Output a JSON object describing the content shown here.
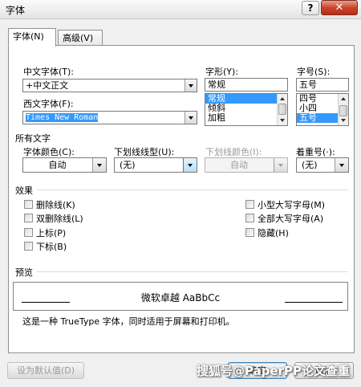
{
  "window": {
    "title": "字体",
    "help": "?",
    "close": "✕"
  },
  "tabs": [
    {
      "label": "字体(N)"
    },
    {
      "label": "高级(V)"
    }
  ],
  "font_tab": {
    "chinese_font": {
      "label": "中文字体(T):",
      "value": "+中文正文"
    },
    "western_font": {
      "label": "西文字体(F):",
      "value": "Times New Roman"
    },
    "style": {
      "label": "字形(Y):",
      "value": "常规",
      "options": [
        "常规",
        "倾斜",
        "加粗"
      ],
      "selected": "常规"
    },
    "size": {
      "label": "字号(S):",
      "value": "五号",
      "options": [
        "四号",
        "小四",
        "五号"
      ],
      "selected": "五号"
    }
  },
  "all_text": {
    "heading": "所有文字",
    "font_color": {
      "label": "字体颜色(C):",
      "value": "自动"
    },
    "underline_type": {
      "label": "下划线线型(U):",
      "value": "(无)"
    },
    "underline_color": {
      "label": "下划线颜色(I):",
      "value": "自动"
    },
    "emphasis": {
      "label": "着重号(·):",
      "value": "(无)"
    }
  },
  "effects": {
    "heading": "效果",
    "left": [
      "删除线(K)",
      "双删除线(L)",
      "上标(P)",
      "下标(B)"
    ],
    "right": [
      "小型大写字母(M)",
      "全部大写字母(A)",
      "隐藏(H)"
    ]
  },
  "preview": {
    "heading": "预览",
    "sample": "微软卓越 AaBbCc",
    "description": "这是一种 TrueType 字体，同时适用于屏幕和打印机。"
  },
  "buttons": {
    "set_default": "设为默认值(D)",
    "ok": "确定",
    "cancel": "取消"
  },
  "watermark": "搜狐号@PaperPP论文查重"
}
